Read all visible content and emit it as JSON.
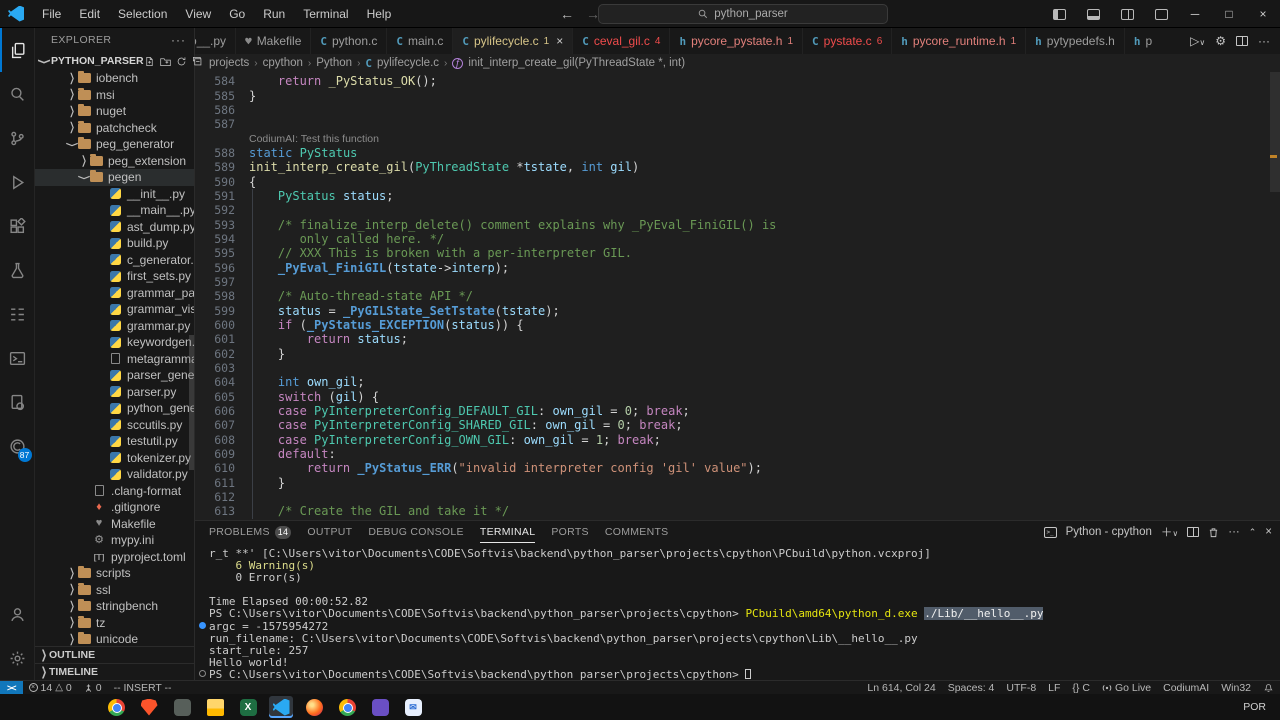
{
  "titlebar": {
    "menus": [
      "File",
      "Edit",
      "Selection",
      "View",
      "Go",
      "Run",
      "Terminal",
      "Help"
    ],
    "search_value": "python_parser",
    "back_arrow": "←",
    "forward_arrow": "→",
    "minimize": "─",
    "restore": "□",
    "close": "×"
  },
  "activity": {
    "codium_badge": "87"
  },
  "explorer": {
    "title": "EXPLORER",
    "project": "PYTHON_PARSER",
    "outline": "OUTLINE",
    "timeline": "TIMELINE",
    "tree": [
      {
        "lvl": 1,
        "chev": "closed",
        "icon": "folder",
        "label": "iobench"
      },
      {
        "lvl": 1,
        "chev": "closed",
        "icon": "folder",
        "label": "msi"
      },
      {
        "lvl": 1,
        "chev": "closed",
        "icon": "folder",
        "label": "nuget"
      },
      {
        "lvl": 1,
        "chev": "closed",
        "icon": "folder",
        "label": "patchcheck"
      },
      {
        "lvl": 1,
        "chev": "open",
        "icon": "folder",
        "label": "peg_generator"
      },
      {
        "lvl": 2,
        "chev": "closed",
        "icon": "folder",
        "label": "peg_extension"
      },
      {
        "lvl": 2,
        "chev": "open",
        "icon": "folder",
        "label": "pegen",
        "hover": true
      },
      {
        "lvl": 3,
        "icon": "py",
        "label": "__init__.py"
      },
      {
        "lvl": 3,
        "icon": "py",
        "label": "__main__.py"
      },
      {
        "lvl": 3,
        "icon": "py",
        "label": "ast_dump.py"
      },
      {
        "lvl": 3,
        "icon": "py",
        "label": "build.py"
      },
      {
        "lvl": 3,
        "icon": "py",
        "label": "c_generator.py"
      },
      {
        "lvl": 3,
        "icon": "py",
        "label": "first_sets.py"
      },
      {
        "lvl": 3,
        "icon": "py",
        "label": "grammar_parser.py"
      },
      {
        "lvl": 3,
        "icon": "py",
        "label": "grammar_visualiz..."
      },
      {
        "lvl": 3,
        "icon": "py",
        "label": "grammar.py"
      },
      {
        "lvl": 3,
        "icon": "py",
        "label": "keywordgen.py"
      },
      {
        "lvl": 3,
        "icon": "file",
        "label": "metagrammar.gr..."
      },
      {
        "lvl": 3,
        "icon": "py",
        "label": "parser_generator...."
      },
      {
        "lvl": 3,
        "icon": "py",
        "label": "parser.py"
      },
      {
        "lvl": 3,
        "icon": "py",
        "label": "python_generato..."
      },
      {
        "lvl": 3,
        "icon": "py",
        "label": "sccutils.py"
      },
      {
        "lvl": 3,
        "icon": "py",
        "label": "testutil.py"
      },
      {
        "lvl": 3,
        "icon": "py",
        "label": "tokenizer.py"
      },
      {
        "lvl": 3,
        "icon": "py",
        "label": "validator.py"
      },
      {
        "lvl": 2,
        "icon": "file",
        "label": ".clang-format"
      },
      {
        "lvl": 2,
        "icon": "git",
        "label": ".gitignore"
      },
      {
        "lvl": 2,
        "icon": "make",
        "label": "Makefile"
      },
      {
        "lvl": 2,
        "icon": "gear",
        "label": "mypy.ini"
      },
      {
        "lvl": 2,
        "icon": "toml",
        "label": "pyproject.toml"
      },
      {
        "lvl": 1,
        "chev": "closed",
        "icon": "folder",
        "label": "scripts"
      },
      {
        "lvl": 1,
        "chev": "closed",
        "icon": "folder",
        "label": "ssl"
      },
      {
        "lvl": 1,
        "chev": "closed",
        "icon": "folder",
        "label": "stringbench"
      },
      {
        "lvl": 1,
        "chev": "closed",
        "icon": "folder",
        "label": "tz"
      },
      {
        "lvl": 1,
        "chev": "closed",
        "icon": "folder",
        "label": "unicode"
      }
    ]
  },
  "tabs": [
    {
      "label": "__hello__.py",
      "icon": "py",
      "clip_left": true
    },
    {
      "label": "Makefile",
      "icon": "make"
    },
    {
      "label": "python.c",
      "icon": "c"
    },
    {
      "label": "main.c",
      "icon": "c"
    },
    {
      "label": "pylifecycle.c",
      "icon": "c",
      "badge": "1",
      "active": true,
      "color": "#d7c588",
      "closable": true
    },
    {
      "label": "ceval_gil.c",
      "icon": "c",
      "badge": "4",
      "color": "#f14c4c"
    },
    {
      "label": "pycore_pystate.h",
      "icon": "h",
      "badge": "1",
      "color": "#e2807b"
    },
    {
      "label": "pystate.c",
      "icon": "c",
      "badge": "6",
      "color": "#f14c4c"
    },
    {
      "label": "pycore_runtime.h",
      "icon": "h",
      "badge": "1",
      "color": "#e2807b"
    },
    {
      "label": "pytypedefs.h",
      "icon": "h"
    },
    {
      "label": "p",
      "icon": "h",
      "clip_right": true
    }
  ],
  "breadcrumbs": [
    {
      "label": "projects"
    },
    {
      "label": "cpython"
    },
    {
      "label": "Python"
    },
    {
      "label": "pylifecycle.c",
      "icon": "c"
    },
    {
      "label": "init_interp_create_gil(PyThreadState *, int)",
      "icon": "symbol"
    }
  ],
  "editor": {
    "code": [
      {
        "n": "584",
        "t": [
          [
            "pl",
            "    "
          ],
          [
            "kw",
            "return"
          ],
          [
            "pl",
            " "
          ],
          [
            "fn",
            "_PyStatus_OK"
          ],
          [
            "pl",
            "();"
          ]
        ]
      },
      {
        "n": "585",
        "t": [
          [
            "pl",
            "}"
          ]
        ]
      },
      {
        "n": "586",
        "t": []
      },
      {
        "n": "587",
        "t": []
      },
      {
        "lens": "CodiumAI: Test this function"
      },
      {
        "n": "588",
        "t": [
          [
            "st",
            "static"
          ],
          [
            "pl",
            " "
          ],
          [
            "ty",
            "PyStatus"
          ]
        ]
      },
      {
        "n": "589",
        "t": [
          [
            "fn",
            "init_interp_create_gil"
          ],
          [
            "pl",
            "("
          ],
          [
            "ty",
            "PyThreadState"
          ],
          [
            "pl",
            " *"
          ],
          [
            "va",
            "tstate"
          ],
          [
            "pl",
            ", "
          ],
          [
            "st",
            "int"
          ],
          [
            "pl",
            " "
          ],
          [
            "va",
            "gil"
          ],
          [
            "pl",
            ")"
          ]
        ]
      },
      {
        "n": "590",
        "t": [
          [
            "pl",
            "{"
          ]
        ]
      },
      {
        "n": "591",
        "t": [
          [
            "pl",
            "    "
          ],
          [
            "ty",
            "PyStatus"
          ],
          [
            "pl",
            " "
          ],
          [
            "va",
            "status"
          ],
          [
            "pl",
            ";"
          ]
        ]
      },
      {
        "n": "592",
        "t": []
      },
      {
        "n": "593",
        "t": [
          [
            "pl",
            "    "
          ],
          [
            "cm",
            "/* finalize_interp_delete() comment explains why _PyEval_FiniGIL() is"
          ]
        ]
      },
      {
        "n": "594",
        "t": [
          [
            "cm",
            "       only called here. */"
          ]
        ]
      },
      {
        "n": "595",
        "t": [
          [
            "pl",
            "    "
          ],
          [
            "cm",
            "// XXX This is broken with a per-interpreter GIL."
          ]
        ]
      },
      {
        "n": "596",
        "t": [
          [
            "pl",
            "    "
          ],
          [
            "mc",
            "_PyEval_FiniGIL"
          ],
          [
            "pl",
            "("
          ],
          [
            "va",
            "tstate"
          ],
          [
            "pl",
            "->"
          ],
          [
            "va",
            "interp"
          ],
          [
            "pl",
            ");"
          ]
        ]
      },
      {
        "n": "597",
        "t": []
      },
      {
        "n": "598",
        "t": [
          [
            "pl",
            "    "
          ],
          [
            "cm",
            "/* Auto-thread-state API */"
          ]
        ]
      },
      {
        "n": "599",
        "t": [
          [
            "pl",
            "    "
          ],
          [
            "va",
            "status"
          ],
          [
            "pl",
            " = "
          ],
          [
            "mc",
            "_PyGILState_SetTstate"
          ],
          [
            "pl",
            "("
          ],
          [
            "va",
            "tstate"
          ],
          [
            "pl",
            ");"
          ]
        ]
      },
      {
        "n": "600",
        "t": [
          [
            "pl",
            "    "
          ],
          [
            "kw",
            "if"
          ],
          [
            "pl",
            " ("
          ],
          [
            "mc",
            "_PyStatus_EXCEPTION"
          ],
          [
            "pl",
            "("
          ],
          [
            "va",
            "status"
          ],
          [
            "pl",
            ")) {"
          ]
        ]
      },
      {
        "n": "601",
        "t": [
          [
            "pl",
            "        "
          ],
          [
            "kw",
            "return"
          ],
          [
            "pl",
            " "
          ],
          [
            "va",
            "status"
          ],
          [
            "pl",
            ";"
          ]
        ]
      },
      {
        "n": "602",
        "t": [
          [
            "pl",
            "    }"
          ]
        ]
      },
      {
        "n": "603",
        "t": []
      },
      {
        "n": "604",
        "t": [
          [
            "pl",
            "    "
          ],
          [
            "st",
            "int"
          ],
          [
            "pl",
            " "
          ],
          [
            "va",
            "own_gil"
          ],
          [
            "pl",
            ";"
          ]
        ]
      },
      {
        "n": "605",
        "t": [
          [
            "pl",
            "    "
          ],
          [
            "kw",
            "switch"
          ],
          [
            "pl",
            " ("
          ],
          [
            "va",
            "gil"
          ],
          [
            "pl",
            ") {"
          ]
        ]
      },
      {
        "n": "606",
        "t": [
          [
            "pl",
            "    "
          ],
          [
            "kw",
            "case"
          ],
          [
            "pl",
            " "
          ],
          [
            "ty",
            "PyInterpreterConfig_DEFAULT_GIL"
          ],
          [
            "pl",
            ": "
          ],
          [
            "va",
            "own_gil"
          ],
          [
            "pl",
            " = "
          ],
          [
            "num",
            "0"
          ],
          [
            "pl",
            "; "
          ],
          [
            "kw",
            "break"
          ],
          [
            "pl",
            ";"
          ]
        ]
      },
      {
        "n": "607",
        "t": [
          [
            "pl",
            "    "
          ],
          [
            "kw",
            "case"
          ],
          [
            "pl",
            " "
          ],
          [
            "ty",
            "PyInterpreterConfig_SHARED_GIL"
          ],
          [
            "pl",
            ": "
          ],
          [
            "va",
            "own_gil"
          ],
          [
            "pl",
            " = "
          ],
          [
            "num",
            "0"
          ],
          [
            "pl",
            "; "
          ],
          [
            "kw",
            "break"
          ],
          [
            "pl",
            ";"
          ]
        ]
      },
      {
        "n": "608",
        "t": [
          [
            "pl",
            "    "
          ],
          [
            "kw",
            "case"
          ],
          [
            "pl",
            " "
          ],
          [
            "ty",
            "PyInterpreterConfig_OWN_GIL"
          ],
          [
            "pl",
            ": "
          ],
          [
            "va",
            "own_gil"
          ],
          [
            "pl",
            " = "
          ],
          [
            "num",
            "1"
          ],
          [
            "pl",
            "; "
          ],
          [
            "kw",
            "break"
          ],
          [
            "pl",
            ";"
          ]
        ]
      },
      {
        "n": "609",
        "t": [
          [
            "pl",
            "    "
          ],
          [
            "kw",
            "default"
          ],
          [
            "pl",
            ":"
          ]
        ]
      },
      {
        "n": "610",
        "t": [
          [
            "pl",
            "        "
          ],
          [
            "kw",
            "return"
          ],
          [
            "pl",
            " "
          ],
          [
            "mc",
            "_PyStatus_ERR"
          ],
          [
            "pl",
            "("
          ],
          [
            "str",
            "\"invalid interpreter config 'gil' value\""
          ],
          [
            "pl",
            ");"
          ]
        ]
      },
      {
        "n": "611",
        "t": [
          [
            "pl",
            "    }"
          ]
        ]
      },
      {
        "n": "612",
        "t": []
      },
      {
        "n": "613",
        "t": [
          [
            "pl",
            "    "
          ],
          [
            "cm",
            "/* Create the GIL and take it */"
          ]
        ]
      }
    ]
  },
  "panel": {
    "tabs": [
      {
        "label": "PROBLEMS",
        "badge": "14"
      },
      {
        "label": "OUTPUT"
      },
      {
        "label": "DEBUG CONSOLE"
      },
      {
        "label": "TERMINAL",
        "active": true
      },
      {
        "label": "PORTS"
      },
      {
        "label": "COMMENTS"
      }
    ],
    "terminal_label": "Python - cpython",
    "terminal_lines": [
      {
        "t": [
          [
            "t",
            "r_t **' [C:\\Users\\vitor\\Documents\\CODE\\Softvis\\backend\\python_parser\\projects\\cpython\\PCbuild\\python.vcxproj]"
          ]
        ]
      },
      {
        "t": [
          [
            "warn",
            "    6 Warning(s)"
          ]
        ]
      },
      {
        "t": [
          [
            "t",
            "    0 Error(s)"
          ]
        ]
      },
      {
        "t": []
      },
      {
        "t": [
          [
            "t",
            "Time Elapsed 00:00:52.82"
          ]
        ]
      },
      {
        "t": [
          [
            "t",
            "PS C:\\Users\\vitor\\Documents\\CODE\\Softvis\\backend\\python_parser\\projects\\cpython> "
          ],
          [
            "cmd",
            "PCbuild\\amd64\\python_d.exe"
          ],
          [
            "t",
            " "
          ],
          [
            "sel",
            "./Lib/__hello__.py"
          ]
        ]
      },
      {
        "dec": "dot",
        "t": [
          [
            "t",
            "argc = -1575954272"
          ]
        ]
      },
      {
        "t": [
          [
            "t",
            "run_filename: C:\\Users\\vitor\\Documents\\CODE\\Softvis\\backend\\python_parser\\projects\\cpython\\Lib\\__hello__.py"
          ]
        ]
      },
      {
        "t": [
          [
            "t",
            "start_rule: 257"
          ]
        ]
      },
      {
        "t": [
          [
            "t",
            "Hello world!"
          ]
        ]
      },
      {
        "dec": "circle",
        "t": [
          [
            "t",
            "PS C:\\Users\\vitor\\Documents\\CODE\\Softvis\\backend\\python_parser\\projects\\cpython> "
          ],
          [
            "cursor",
            ""
          ]
        ]
      }
    ]
  },
  "statusbar": {
    "remote": "><",
    "errors": "14",
    "warnings": "0",
    "ports": "0",
    "mode": "-- INSERT --",
    "right": [
      {
        "label": "Ln 614, Col 24"
      },
      {
        "label": "Spaces: 4"
      },
      {
        "label": "UTF-8"
      },
      {
        "label": "LF"
      },
      {
        "label": "{} C"
      },
      {
        "label": "Go Live",
        "icon": "broadcast"
      },
      {
        "label": "CodiumAI"
      },
      {
        "label": "Win32"
      },
      {
        "label": "",
        "icon": "bell"
      }
    ]
  },
  "taskbar": {
    "language": "POR",
    "icons": [
      {
        "name": "start-button",
        "glyph": "start"
      },
      {
        "name": "firefox",
        "glyph": "firefox"
      },
      {
        "name": "chrome",
        "glyph": "chrome"
      },
      {
        "name": "brave",
        "glyph": "brave"
      },
      {
        "name": "notebook-app",
        "glyph": "note"
      },
      {
        "name": "file-explorer",
        "glyph": "expl"
      },
      {
        "name": "excel",
        "glyph": "excel",
        "letter": "X"
      },
      {
        "name": "vscode",
        "glyph": "vscode",
        "active": true
      },
      {
        "name": "firefox-dev",
        "glyph": "ffdev"
      },
      {
        "name": "chrome-secondary",
        "glyph": "chrome"
      },
      {
        "name": "library-app",
        "glyph": "lib"
      },
      {
        "name": "mail",
        "glyph": "mail",
        "letter": "✉"
      }
    ]
  }
}
